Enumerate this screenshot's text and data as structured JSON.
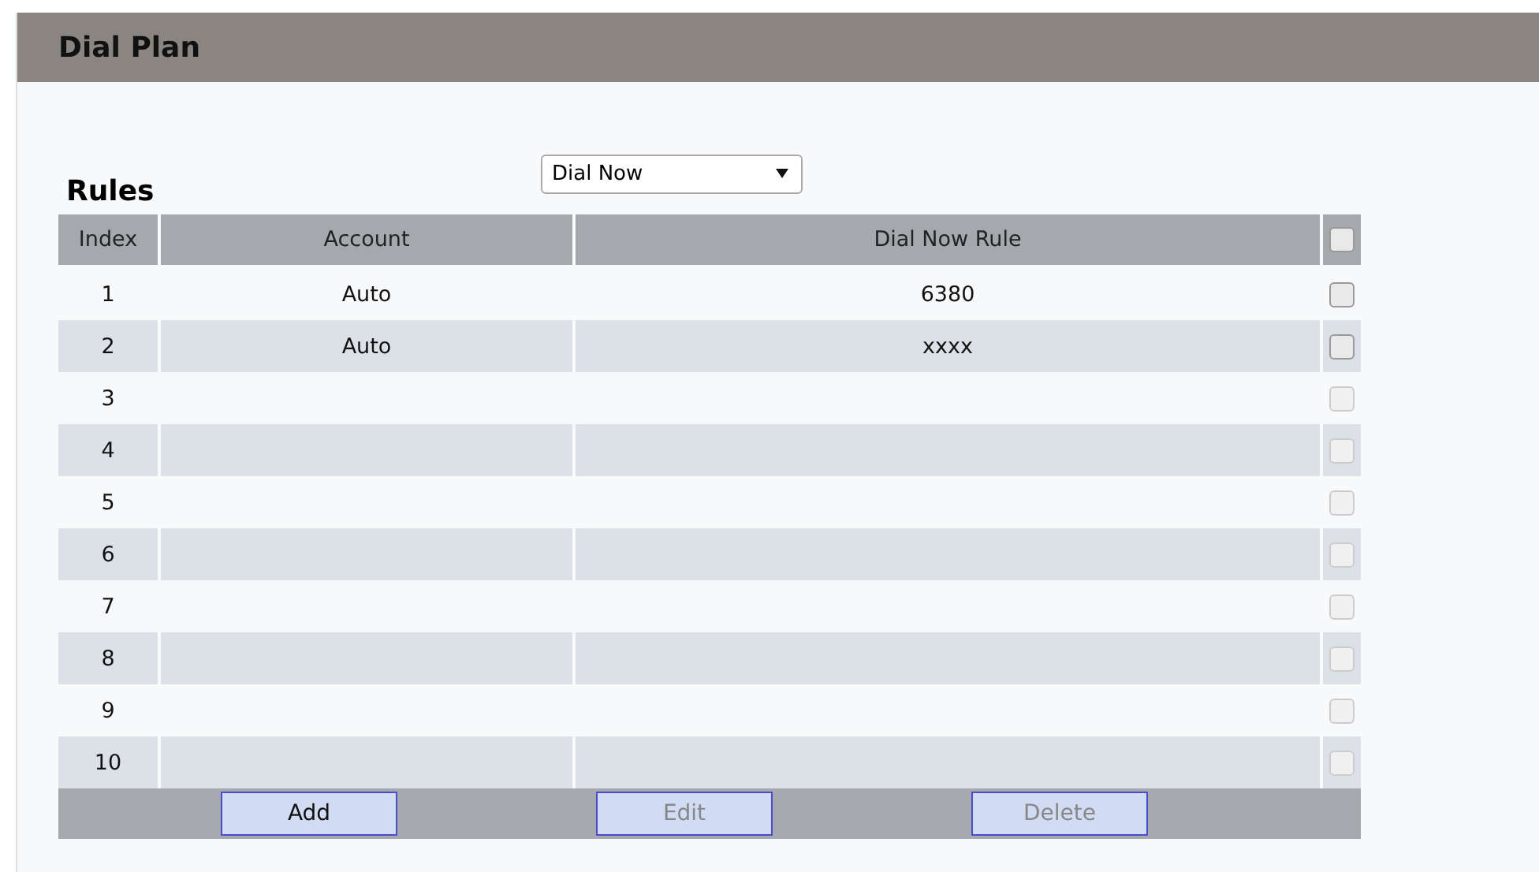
{
  "panel": {
    "title": "Dial Plan"
  },
  "rules": {
    "heading": "Rules",
    "mode": {
      "value": "Dial Now"
    }
  },
  "table": {
    "columns": [
      "Index",
      "Account",
      "Dial Now Rule"
    ],
    "select_all": {
      "checked": false,
      "disabled": false
    },
    "rows": [
      {
        "index": "1",
        "account": "Auto",
        "rule": "6380",
        "checked": false,
        "disabled": false
      },
      {
        "index": "2",
        "account": "Auto",
        "rule": "xxxx",
        "checked": false,
        "disabled": false
      },
      {
        "index": "3",
        "checked": false,
        "disabled": true
      },
      {
        "index": "4",
        "checked": false,
        "disabled": true
      },
      {
        "index": "5",
        "checked": false,
        "disabled": true
      },
      {
        "index": "6",
        "checked": false,
        "disabled": true
      },
      {
        "index": "7",
        "checked": false,
        "disabled": true
      },
      {
        "index": "8",
        "checked": false,
        "disabled": true
      },
      {
        "index": "9",
        "checked": false,
        "disabled": true
      },
      {
        "index": "10",
        "checked": false,
        "disabled": true
      }
    ]
  },
  "buttons": [
    {
      "label": "Add",
      "disabled": false
    },
    {
      "label": "Edit",
      "disabled": true
    },
    {
      "label": "Delete",
      "disabled": true
    }
  ]
}
